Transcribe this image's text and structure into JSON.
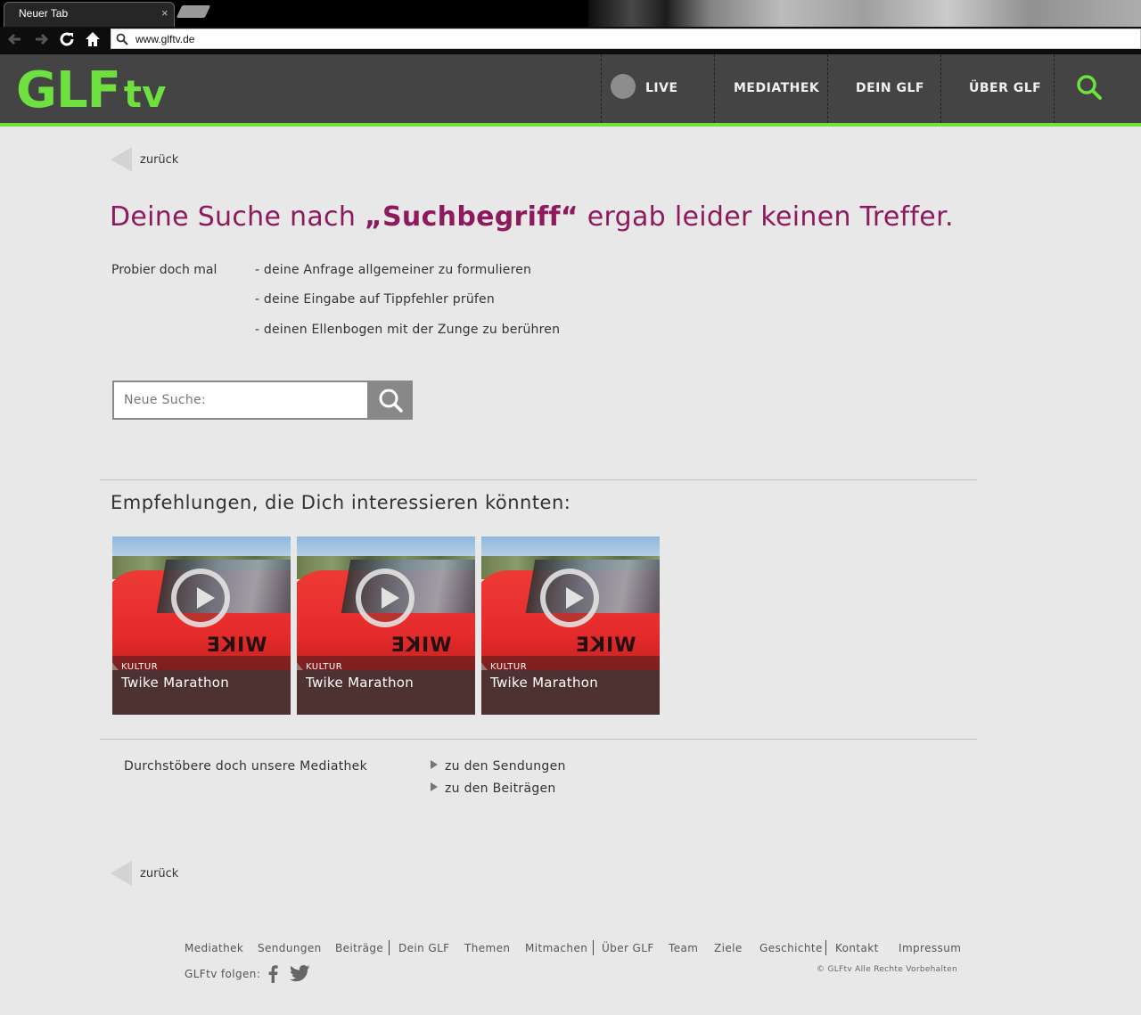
{
  "browser": {
    "tab_title": "Neuer Tab",
    "tab_close": "×",
    "url": "www.glftv.de"
  },
  "header": {
    "logo_main": "GLF",
    "logo_suffix": "tv",
    "nav": [
      {
        "label": "LIVE"
      },
      {
        "label": "MEDIATHEK"
      },
      {
        "label": "DEIN GLF"
      },
      {
        "label": "ÜBER GLF"
      }
    ],
    "accent_color": "#6ee03f"
  },
  "back_label": "zurück",
  "headline": {
    "prefix": "Deine Suche nach ",
    "term": "„Suchbegriff“",
    "suffix": " ergab leider keinen Treffer."
  },
  "tips": {
    "label": "Probier doch mal",
    "items": [
      "- deine Anfrage allgemeiner zu formulieren",
      "- deine Eingabe auf Tippfehler prüfen",
      "- deinen Ellenbogen mit der Zunge zu berühren"
    ]
  },
  "search": {
    "placeholder": "Neue Suche:"
  },
  "recommendations": {
    "heading": "Empfehlungen, die Dich interessieren könnten:",
    "cards": [
      {
        "category": "KULTUR",
        "title": "Twike Marathon",
        "brand": "WIKE"
      },
      {
        "category": "KULTUR",
        "title": "Twike Marathon",
        "brand": "WIKE"
      },
      {
        "category": "KULTUR",
        "title": "Twike Marathon",
        "brand": "WIKE"
      }
    ]
  },
  "browse": {
    "label": "Durchstöbere doch unsere Mediathek",
    "links": [
      "zu den Sendungen",
      "zu den Beiträgen"
    ]
  },
  "footer": {
    "links": [
      "Mediathek",
      "Sendungen",
      "Beiträge",
      "Dein GLF",
      "Themen",
      "Mitmachen",
      "Über GLF",
      "Team",
      "Ziele",
      "Geschichte",
      "Kontakt",
      "Impressum"
    ],
    "follow_label": "GLFtv folgen:",
    "copyright": "© GLFtv Alle Rechte Vorbehalten"
  },
  "colors": {
    "headline": "#8e1a5e",
    "header_bg": "#444444",
    "page_bg": "#e8e8e8"
  }
}
